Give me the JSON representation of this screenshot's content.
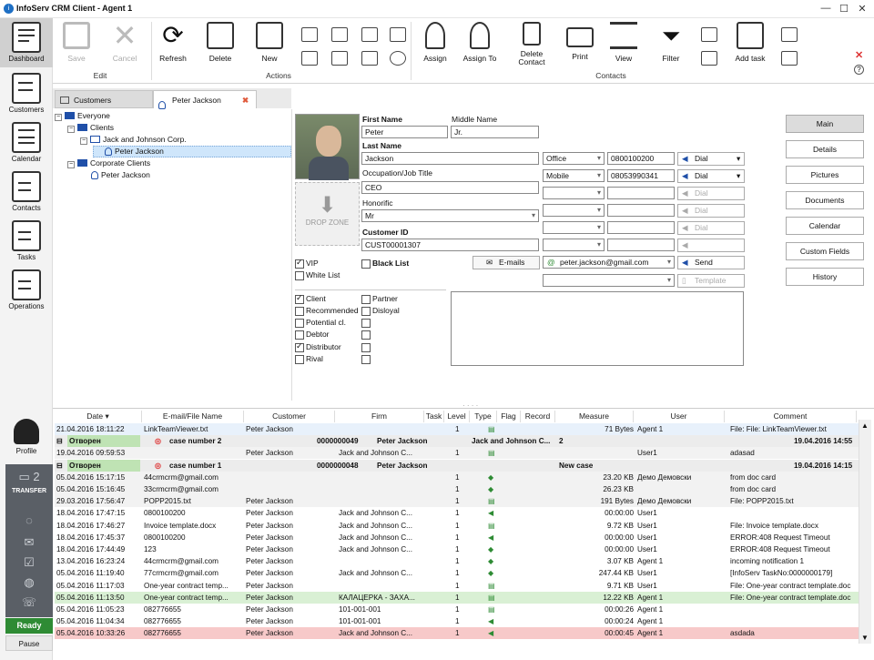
{
  "window": {
    "title": "InfoServ CRM Client - Agent 1",
    "minimize": "—",
    "maximize": "☐",
    "close": "✕"
  },
  "nav": {
    "items": [
      {
        "label": "Dashboard",
        "icon": "dashboard-icon"
      },
      {
        "label": "Customers",
        "icon": "customers-icon"
      },
      {
        "label": "Calendar",
        "icon": "calendar-icon"
      },
      {
        "label": "Contacts",
        "icon": "contacts-icon"
      },
      {
        "label": "Tasks",
        "icon": "tasks-icon"
      },
      {
        "label": "Operations",
        "icon": "operations-icon"
      }
    ],
    "profile": "Profile",
    "transfer": "TRANSFER",
    "ready": "Ready",
    "pause": "Pause"
  },
  "ribbon": {
    "save": "Save",
    "cancel": "Cancel",
    "edit_group": "Edit",
    "refresh": "Refresh",
    "delete": "Delete",
    "new": "New",
    "actions_group": "Actions",
    "assign": "Assign",
    "assign_to": "Assign To",
    "delete_contact": "Delete Contact",
    "print": "Print",
    "view": "View",
    "filter": "Filter",
    "add_task": "Add task",
    "contacts_group": "Contacts"
  },
  "tabs": [
    {
      "label": "Customers"
    },
    {
      "label": "Peter Jackson"
    }
  ],
  "tree": [
    "Everyone",
    "Clients",
    "Jack and Johnson Corp.",
    "Peter Jackson",
    "Corporate Clients",
    "Peter Jackson"
  ],
  "form": {
    "first_name_label": "First Name",
    "first_name": "Peter",
    "middle_name_label": "Middle Name",
    "middle_name": "Jr.",
    "last_name_label": "Last Name",
    "last_name": "Jackson",
    "occupation_label": "Occupation/Job Title",
    "occupation": "CEO",
    "honorific_label": "Honorific",
    "honorific": "Mr",
    "customer_id_label": "Customer ID",
    "customer_id": "CUST00001307",
    "drop_zone": "DROP ZONE",
    "phones": [
      {
        "type": "Office",
        "number": "0800100200",
        "dial": "Dial"
      },
      {
        "type": "Mobile",
        "number": "08053990341",
        "dial": "Dial"
      },
      {
        "type": "",
        "number": "",
        "dial": "Dial"
      },
      {
        "type": "",
        "number": "",
        "dial": "Dial"
      },
      {
        "type": "",
        "number": "",
        "dial": "Dial"
      },
      {
        "type": "",
        "number": "",
        "dial": ""
      }
    ],
    "emails_button": "E-mails",
    "email": "peter.jackson@gmail.com",
    "send": "Send",
    "template": "Template",
    "vip": "VIP",
    "white_list": "White List",
    "black_list": "Black List",
    "checks_left": [
      {
        "label": "Client",
        "checked": true
      },
      {
        "label": "Recommended",
        "checked": false
      },
      {
        "label": "Potential cl.",
        "checked": false
      },
      {
        "label": "Debtor",
        "checked": false
      },
      {
        "label": "Distributor",
        "checked": true
      },
      {
        "label": "Rival",
        "checked": false
      }
    ],
    "checks_right": [
      {
        "label": "Partner",
        "checked": false
      },
      {
        "label": "Disloyal",
        "checked": false
      },
      {
        "label": "",
        "checked": false
      },
      {
        "label": "",
        "checked": false
      },
      {
        "label": "",
        "checked": false
      },
      {
        "label": "",
        "checked": false
      }
    ]
  },
  "right_buttons": [
    "Main",
    "Details",
    "Pictures",
    "Documents",
    "Calendar",
    "Custom Fields",
    "History"
  ],
  "grid": {
    "headers": [
      "Date",
      "E-mail/File Name",
      "Customer",
      "Firm",
      "Task",
      "Level",
      "Type",
      "Flag",
      "Record",
      "Measure",
      "User",
      "Comment"
    ],
    "rows": [
      {
        "date": "21.04.2016 18:11:22",
        "file": "LinkTeamViewer.txt",
        "customer": "Peter Jackson",
        "firm": "",
        "level": "1",
        "measure": "71 Bytes",
        "user": "Agent 1",
        "comment": "File: File: LinkTeamViewer.txt",
        "bg": "#e8f1fb"
      },
      {
        "group": true,
        "status": "Отворен",
        "case": "case number 2",
        "num": "0000000049",
        "who": "Peter Jackson",
        "firm": "Jack and Johnson C...",
        "lvl": "2",
        "gdate": "19.04.2016 14:55"
      },
      {
        "date": "19.04.2016 09:59:53",
        "file": "",
        "customer": "Peter Jackson",
        "firm": "Jack and Johnson C...",
        "level": "1",
        "measure": "",
        "user": "User1",
        "comment": "adasad",
        "bg": "#f2f2f2"
      },
      {
        "group": true,
        "status": "Отворен",
        "case": "case number 1",
        "num": "0000000048",
        "who": "Peter Jackson",
        "firm": "",
        "lvl": "New case",
        "gdate": "19.04.2016 14:15"
      },
      {
        "date": "05.04.2016 15:17:15",
        "file": "44crmcrm@gmail.com",
        "customer": "",
        "firm": "",
        "level": "1",
        "measure": "23.20 KB",
        "user": "Демо Демовски",
        "comment": "from doc card",
        "bg": "#f2f2f2"
      },
      {
        "date": "05.04.2016 15:16:45",
        "file": "33crmcrm@gmail.com",
        "customer": "",
        "firm": "",
        "level": "1",
        "measure": "26.23 KB",
        "user": "",
        "comment": "from doc card",
        "bg": "#f2f2f2"
      },
      {
        "date": "29.03.2016 17:56:47",
        "file": "POPP2015.txt",
        "customer": "Peter Jackson",
        "firm": "",
        "level": "1",
        "measure": "191 Bytes",
        "user": "Демо Демовски",
        "comment": "File: POPP2015.txt",
        "bg": "#f2f2f2"
      },
      {
        "date": "18.04.2016 17:47:15",
        "file": "0800100200",
        "customer": "Peter Jackson",
        "firm": "Jack and Johnson C...",
        "level": "1",
        "measure": "00:00:00",
        "user": "User1",
        "comment": "",
        "bg": "#fff"
      },
      {
        "date": "18.04.2016 17:46:27",
        "file": "Invoice template.docx",
        "customer": "Peter Jackson",
        "firm": "Jack and Johnson C...",
        "level": "1",
        "measure": "9.72 KB",
        "user": "User1",
        "comment": "File: Invoice template.docx",
        "bg": "#fff"
      },
      {
        "date": "18.04.2016 17:45:37",
        "file": "0800100200",
        "customer": "Peter Jackson",
        "firm": "Jack and Johnson C...",
        "level": "1",
        "measure": "00:00:00",
        "user": "User1",
        "comment": "ERROR:408 Request Timeout",
        "bg": "#fff"
      },
      {
        "date": "18.04.2016 17:44:49",
        "file": "123",
        "customer": "Peter Jackson",
        "firm": "Jack and Johnson C...",
        "level": "1",
        "measure": "00:00:00",
        "user": "User1",
        "comment": "ERROR:408 Request Timeout",
        "bg": "#fff"
      },
      {
        "date": "13.04.2016 16:23:24",
        "file": "44crmcrm@gmail.com",
        "customer": "Peter Jackson",
        "firm": "",
        "level": "1",
        "measure": "3.07 KB",
        "user": "Agent 1",
        "comment": "incoming notification 1",
        "bg": "#fff"
      },
      {
        "date": "05.04.2016 11:19:40",
        "file": "77crmcrm@gmail.com",
        "customer": "Peter Jackson",
        "firm": "Jack and Johnson C...",
        "level": "1",
        "measure": "247.44 KB",
        "user": "User1",
        "comment": "[InfoServ TaskNo:0000000179]",
        "bg": "#fff"
      },
      {
        "date": "05.04.2016 11:17:03",
        "file": "One-year contract temp...",
        "customer": "Peter Jackson",
        "firm": "",
        "level": "1",
        "measure": "9.71 KB",
        "user": "User1",
        "comment": "File: One-year contract template.doc",
        "bg": "#fff"
      },
      {
        "date": "05.04.2016 11:13:50",
        "file": "One-year contract temp...",
        "customer": "Peter Jackson",
        "firm": "КАЛАЦЕРКА - ЗАХА...",
        "level": "1",
        "measure": "12.22 KB",
        "user": "Agent 1",
        "comment": "File: One-year contract template.doc",
        "bg": "#d9f0d4"
      },
      {
        "date": "05.04.2016 11:05:23",
        "file": "082776655",
        "customer": "Peter Jackson",
        "firm": "101-001-001",
        "level": "1",
        "measure": "00:00:26",
        "user": "Agent 1",
        "comment": "",
        "bg": "#fff"
      },
      {
        "date": "05.04.2016 11:04:34",
        "file": "082776655",
        "customer": "Peter Jackson",
        "firm": "101-001-001",
        "level": "1",
        "measure": "00:00:24",
        "user": "Agent 1",
        "comment": "",
        "bg": "#fff"
      },
      {
        "date": "05.04.2016 10:33:26",
        "file": "082776655",
        "customer": "Peter Jackson",
        "firm": "Jack and Johnson C...",
        "level": "1",
        "measure": "00:00:45",
        "user": "Agent 1",
        "comment": "asdada",
        "bg": "#f7c9c9"
      }
    ]
  }
}
